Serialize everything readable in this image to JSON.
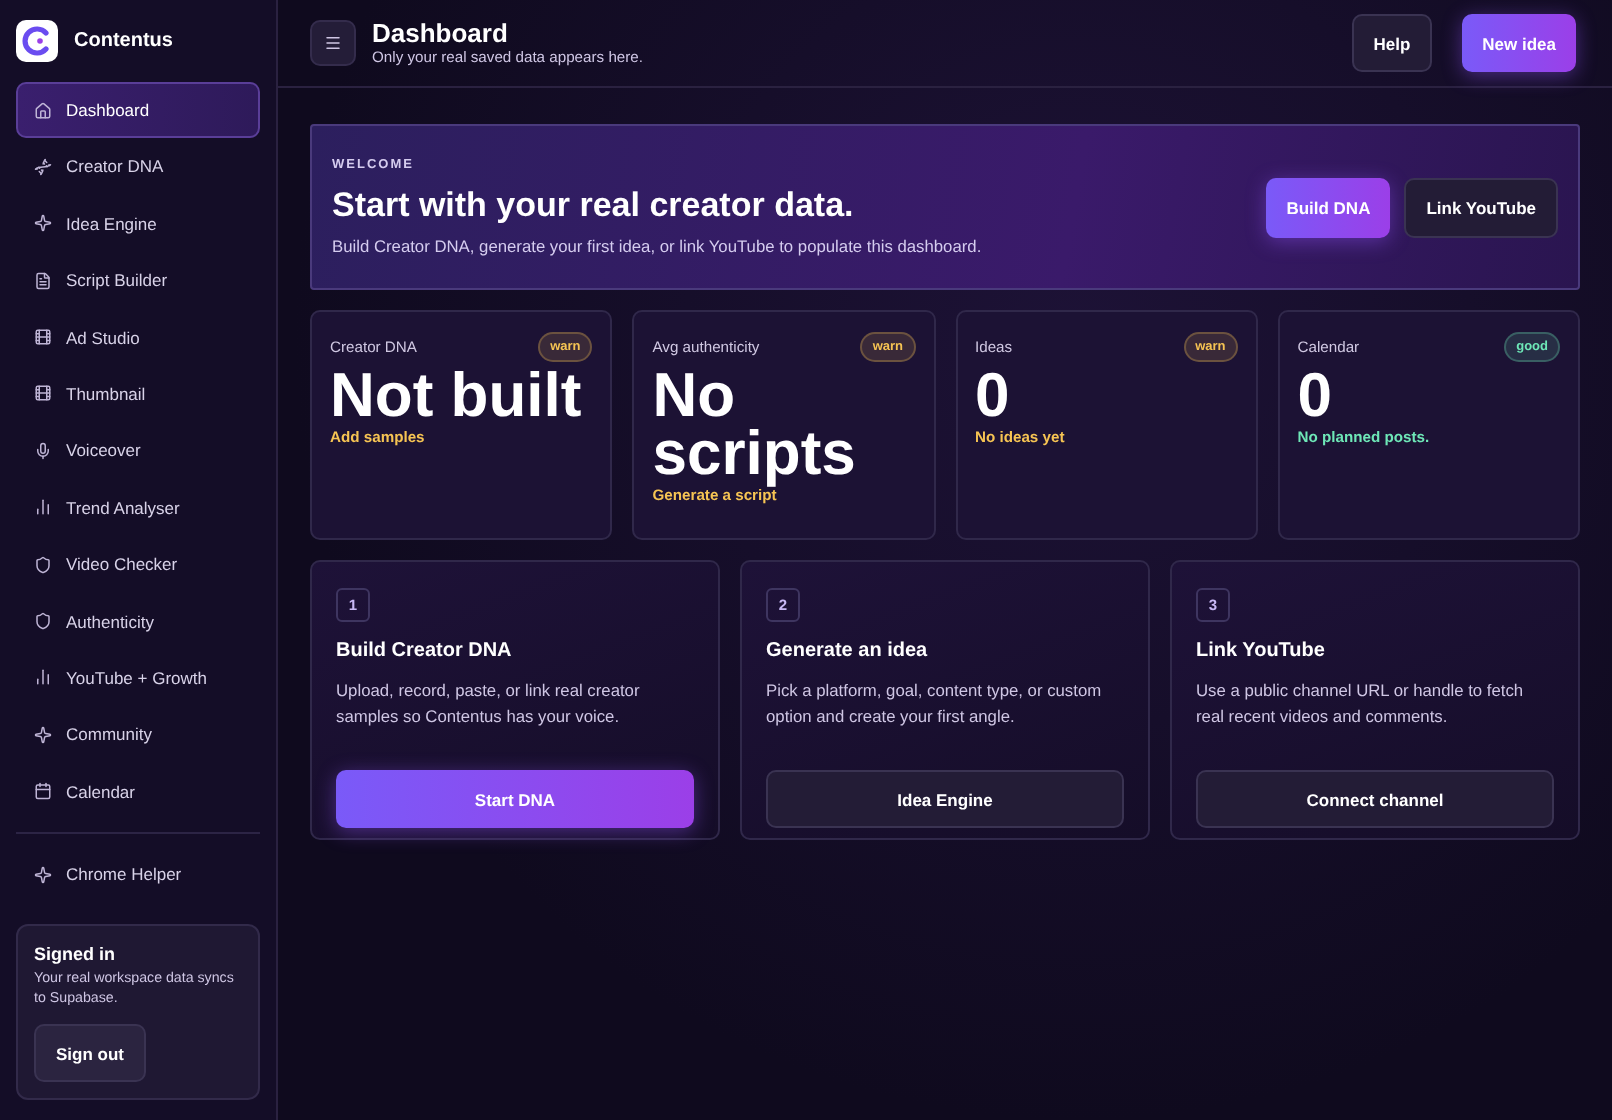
{
  "brand": {
    "name": "Contentus"
  },
  "nav": [
    {
      "label": "Dashboard",
      "selected": true
    },
    {
      "label": "Creator DNA",
      "selected": false
    },
    {
      "label": "Idea Engine",
      "selected": false
    },
    {
      "label": "Script Builder",
      "selected": false
    },
    {
      "label": "Ad Studio",
      "selected": false
    },
    {
      "label": "Thumbnail",
      "selected": false
    },
    {
      "label": "Voiceover",
      "selected": false
    },
    {
      "label": "Trend Analyser",
      "selected": false
    },
    {
      "label": "Video Checker",
      "selected": false
    },
    {
      "label": "Authenticity",
      "selected": false
    },
    {
      "label": "YouTube + Growth",
      "selected": false
    },
    {
      "label": "Community",
      "selected": false
    },
    {
      "label": "Calendar",
      "selected": false
    }
  ],
  "helper": {
    "label": "Chrome Helper"
  },
  "account": {
    "title": "Signed in",
    "text": "Your real workspace data syncs to Supabase.",
    "button": "Sign out"
  },
  "header": {
    "title": "Dashboard",
    "subtitle": "Only your real saved data appears here.",
    "buttons": [
      {
        "label": "Help",
        "kind": "secondary"
      },
      {
        "label": "New idea",
        "kind": "primary"
      }
    ]
  },
  "welcome": {
    "eyebrow": "WELCOME",
    "title": "Start with your real creator data.",
    "text": "Build Creator DNA, generate your first idea, or link YouTube to populate this dashboard.",
    "buttons": [
      {
        "label": "Build DNA",
        "kind": "primary"
      },
      {
        "label": "Link YouTube",
        "kind": "secondary"
      }
    ]
  },
  "stats": [
    {
      "label": "Creator DNA",
      "badge": "warn",
      "color": "#f6c453",
      "value": "Not built",
      "note": "Add samples"
    },
    {
      "label": "Avg authenticity",
      "badge": "warn",
      "color": "#f6c453",
      "value": "No scripts",
      "note": "Generate a script"
    },
    {
      "label": "Ideas",
      "badge": "warn",
      "color": "#f6c453",
      "value": "0",
      "note": "No ideas yet"
    },
    {
      "label": "Calendar",
      "badge": "good",
      "color": "#6ee7b7",
      "value": "0",
      "note": "No planned posts."
    }
  ],
  "steps": [
    {
      "number": "1",
      "title": "Build Creator DNA",
      "text": "Upload, record, paste, or link real creator samples so Contentus has your voice.",
      "button": "Start DNA",
      "kind": "primary"
    },
    {
      "number": "2",
      "title": "Generate an idea",
      "text": "Pick a platform, goal, content type, or custom option and create your first angle.",
      "button": "Idea Engine",
      "kind": "secondary"
    },
    {
      "number": "3",
      "title": "Link YouTube",
      "text": "Use a public channel URL or handle to fetch real recent videos and comments.",
      "button": "Connect channel",
      "kind": "secondary"
    }
  ]
}
